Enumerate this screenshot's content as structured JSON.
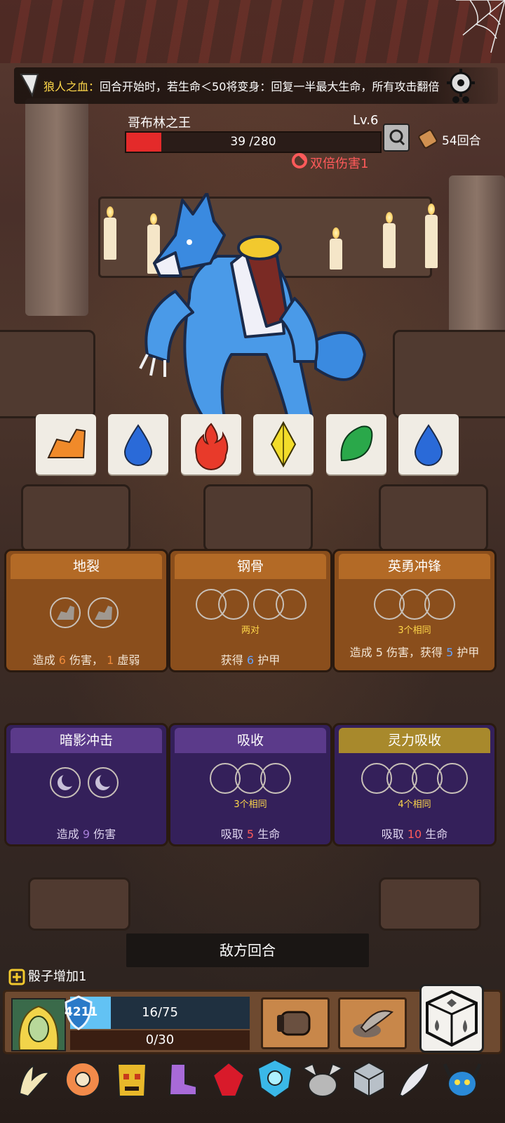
{
  "buff": {
    "name": "狼人之血：",
    "description": "回合开始时，若生命＜50将变身：回复一半最大生命，所有攻击翻倍"
  },
  "enemy": {
    "name": "哥布林之王",
    "level": "Lv.6",
    "hp_text": "39 /280",
    "hp_current": 39,
    "hp_max": 280,
    "status_effect": "双倍伤害1"
  },
  "turn_counter": "54回合",
  "dice_faces": [
    "rock",
    "water",
    "fire",
    "diamond",
    "leaf",
    "water"
  ],
  "skills": [
    {
      "title": "地裂",
      "theme": "orange",
      "slots": 2,
      "slot_icon": "rock-icon",
      "requirement": "",
      "desc_prefix": "造成",
      "desc_val1": "6",
      "desc_mid": "伤害，",
      "desc_val2": "1",
      "desc_suffix": "虚弱"
    },
    {
      "title": "钢骨",
      "theme": "orange",
      "slots": 4,
      "slot_icon": "",
      "requirement": "两对",
      "desc_prefix": "获得",
      "desc_val1": "6",
      "desc_mid": "护甲",
      "desc_val2": "",
      "desc_suffix": ""
    },
    {
      "title": "英勇冲锋",
      "theme": "orange",
      "slots": 3,
      "slot_icon": "",
      "requirement": "3个相同",
      "desc_prefix": "造成",
      "desc_val1": "5",
      "desc_mid": "伤害，获得",
      "desc_val2": "5",
      "desc_suffix": "护甲"
    },
    {
      "title": "暗影冲击",
      "theme": "purple",
      "slots": 2,
      "slot_icon": "moon-icon",
      "requirement": "",
      "desc_prefix": "造成",
      "desc_val1": "9",
      "desc_mid": "伤害",
      "desc_val2": "",
      "desc_suffix": ""
    },
    {
      "title": "吸收",
      "theme": "purple",
      "slots": 3,
      "slot_icon": "",
      "requirement": "3个相同",
      "desc_prefix": "吸取",
      "desc_val1": "5",
      "desc_mid": "生命",
      "desc_val2": "",
      "desc_suffix": ""
    },
    {
      "title": "灵力吸收",
      "theme": "purple",
      "slots": 4,
      "slot_icon": "",
      "requirement": "4个相同",
      "desc_prefix": "吸取",
      "desc_val1": "10",
      "desc_mid": "生命",
      "desc_val2": "",
      "desc_suffix": ""
    }
  ],
  "turn_banner": "敌方回合",
  "dice_bonus": "骰子增加1",
  "player": {
    "shield": "4211",
    "hp_text": "16/75",
    "xp_text": "0/30"
  },
  "colors": {
    "hp_red": "#e42a2a",
    "gold_text": "#ffd84a",
    "status_red": "#ff5a5a"
  }
}
